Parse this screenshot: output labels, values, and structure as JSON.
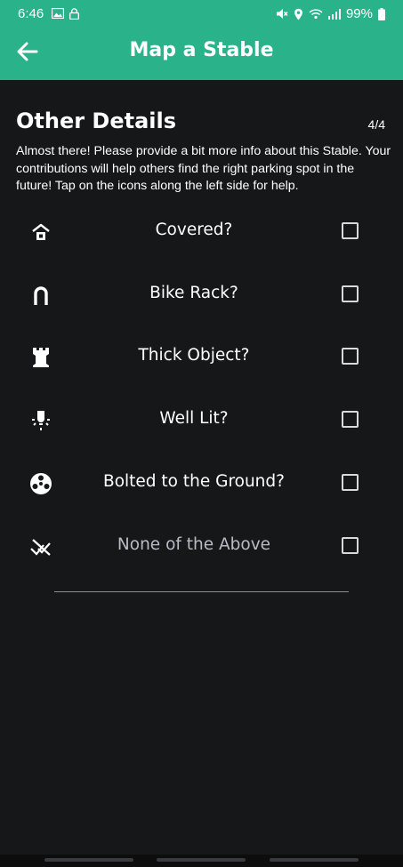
{
  "status_bar": {
    "time": "6:46",
    "battery": "99%"
  },
  "app_bar": {
    "title": "Map a Stable"
  },
  "page": {
    "title": "Other Details",
    "step": "4/4",
    "description": "Almost there! Please provide a bit more info about this Stable. Your contributions will help others find the right parking spot in the future! Tap on the icons along the left side for help."
  },
  "options": [
    {
      "label": "Covered?",
      "icon": "covered-house-icon",
      "checked": false
    },
    {
      "label": "Bike Rack?",
      "icon": "bike-rack-icon",
      "checked": false
    },
    {
      "label": "Thick Object?",
      "icon": "tower-icon",
      "checked": false
    },
    {
      "label": "Well Lit?",
      "icon": "light-bulb-icon",
      "checked": false
    },
    {
      "label": "Bolted to the Ground?",
      "icon": "bolt-icon",
      "checked": false
    },
    {
      "label": "None of the Above",
      "icon": "none-icon",
      "checked": false
    }
  ],
  "colors": {
    "accent": "#2ab28a",
    "background": "#161719",
    "muted_text": "#b8bcc4"
  }
}
